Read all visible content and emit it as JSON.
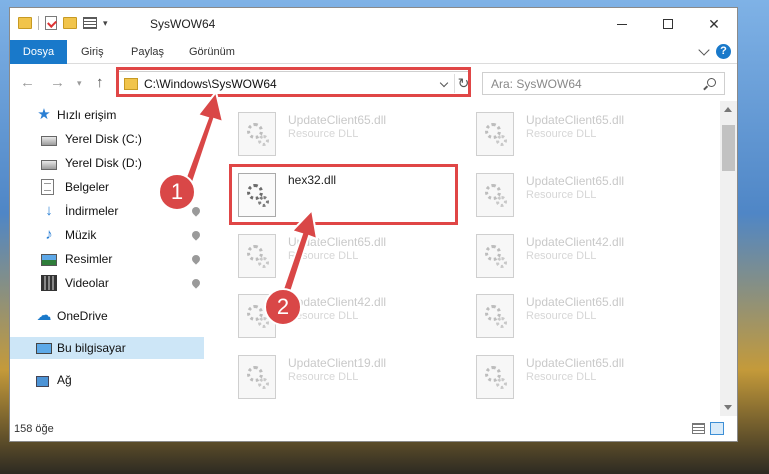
{
  "window": {
    "title": "SysWOW64"
  },
  "ribbon": {
    "tabs": [
      "Dosya",
      "Giriş",
      "Paylaş",
      "Görünüm"
    ]
  },
  "address": {
    "path": "C:\\Windows\\SysWOW64"
  },
  "search": {
    "placeholder": "Ara: SysWOW64"
  },
  "sidebar": {
    "items": [
      {
        "label": "Hızlı erişim",
        "icon": "star-icon"
      },
      {
        "label": "Yerel Disk (C:)",
        "icon": "drive-icon"
      },
      {
        "label": "Yerel Disk (D:)",
        "icon": "drive-icon"
      },
      {
        "label": "Belgeler",
        "icon": "documents-icon"
      },
      {
        "label": "İndirmeler",
        "icon": "download-icon"
      },
      {
        "label": "Müzik",
        "icon": "music-icon"
      },
      {
        "label": "Resimler",
        "icon": "pictures-icon"
      },
      {
        "label": "Videolar",
        "icon": "video-icon"
      },
      {
        "label": "OneDrive",
        "icon": "cloud-icon"
      },
      {
        "label": "Bu bilgisayar",
        "icon": "computer-icon"
      },
      {
        "label": "Ağ",
        "icon": "network-icon"
      }
    ]
  },
  "files": {
    "left": [
      {
        "name": "UpdateClient65.dll",
        "type": "Resource DLL"
      },
      {
        "name": "hex32.dll",
        "type": ""
      },
      {
        "name": "UpdateClient65.dll",
        "type": "Resource DLL"
      },
      {
        "name": "UpdateClient42.dll",
        "type": "Resource DLL"
      },
      {
        "name": "UpdateClient19.dll",
        "type": "Resource DLL"
      }
    ],
    "right": [
      {
        "name": "UpdateClient65.dll",
        "type": "Resource DLL"
      },
      {
        "name": "UpdateClient65.dll",
        "type": "Resource DLL"
      },
      {
        "name": "UpdateClient42.dll",
        "type": "Resource DLL"
      },
      {
        "name": "UpdateClient65.dll",
        "type": "Resource DLL"
      },
      {
        "name": "UpdateClient65.dll",
        "type": "Resource DLL"
      }
    ]
  },
  "status": {
    "count": "158 öğe"
  },
  "callouts": {
    "first": "1",
    "second": "2"
  },
  "colors": {
    "accent": "#1979ca",
    "highlight": "#e04646",
    "badge": "#d94747"
  }
}
